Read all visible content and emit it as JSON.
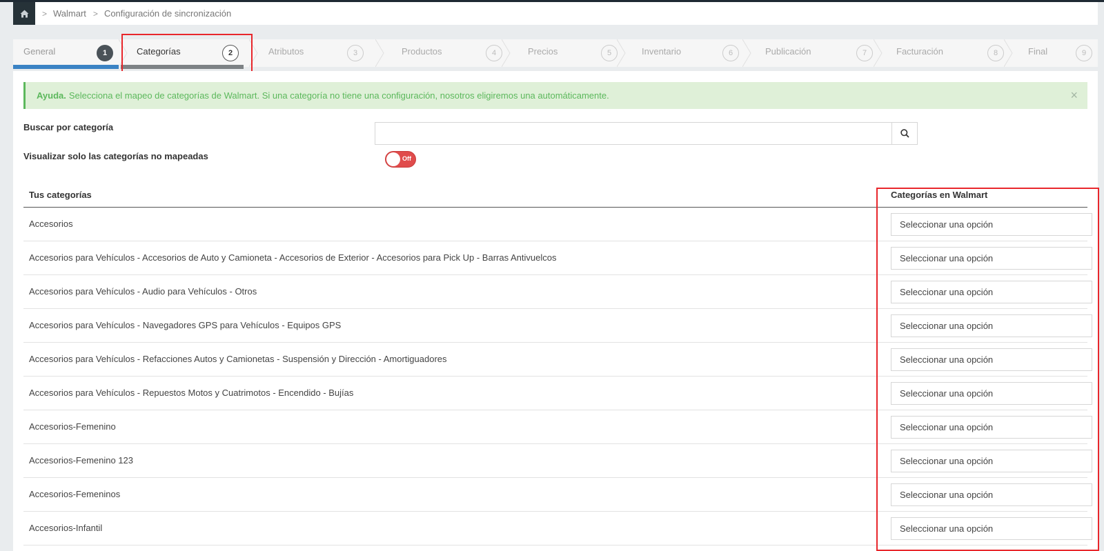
{
  "breadcrumb": {
    "home_icon": "home-icon",
    "items": [
      "Walmart",
      "Configuración de sincronización"
    ]
  },
  "wizard": {
    "steps": [
      {
        "label": "General",
        "num": "1",
        "state": "done"
      },
      {
        "label": "Categorías",
        "num": "2",
        "state": "active"
      },
      {
        "label": "Atributos",
        "num": "3",
        "state": "pending"
      },
      {
        "label": "Productos",
        "num": "4",
        "state": "pending"
      },
      {
        "label": "Precios",
        "num": "5",
        "state": "pending"
      },
      {
        "label": "Inventario",
        "num": "6",
        "state": "pending"
      },
      {
        "label": "Publicación",
        "num": "7",
        "state": "pending"
      },
      {
        "label": "Facturación",
        "num": "8",
        "state": "pending"
      },
      {
        "label": "Final",
        "num": "9",
        "state": "pending"
      }
    ]
  },
  "alert": {
    "bold": "Ayuda.",
    "text": "Selecciona el mapeo de categorías de Walmart. Si una categoría no tiene una configuración, nosotros eligiremos una automáticamente.",
    "close": "×"
  },
  "search": {
    "label": "Buscar por categoría",
    "value": "",
    "placeholder": ""
  },
  "filter": {
    "label": "Visualizar solo las categorías no mapeadas",
    "toggle_text": "Off"
  },
  "table": {
    "col_left": "Tus categorías",
    "col_right": "Categorías en Walmart",
    "rows": [
      {
        "category": "Accesorios",
        "walmart": "Seleccionar una opción"
      },
      {
        "category": "Accesorios para Vehículos - Accesorios de Auto y Camioneta - Accesorios de Exterior - Accesorios para Pick Up - Barras Antivuelcos",
        "walmart": "Seleccionar una opción"
      },
      {
        "category": "Accesorios para Vehículos - Audio para Vehículos - Otros",
        "walmart": "Seleccionar una opción"
      },
      {
        "category": "Accesorios para Vehículos - Navegadores GPS para Vehículos - Equipos GPS",
        "walmart": "Seleccionar una opción"
      },
      {
        "category": "Accesorios para Vehículos - Refacciones Autos y Camionetas - Suspensión y Dirección - Amortiguadores",
        "walmart": "Seleccionar una opción"
      },
      {
        "category": "Accesorios para Vehículos - Repuestos Motos y Cuatrimotos - Encendido - Bujías",
        "walmart": "Seleccionar una opción"
      },
      {
        "category": "Accesorios-Femenino",
        "walmart": "Seleccionar una opción"
      },
      {
        "category": "Accesorios-Femenino 123",
        "walmart": "Seleccionar una opción"
      },
      {
        "category": "Accesorios-Femeninos",
        "walmart": "Seleccionar una opción"
      },
      {
        "category": "Accesorios-Infantil",
        "walmart": "Seleccionar una opción"
      }
    ]
  },
  "colors": {
    "accent_blue": "#3b83c4",
    "highlight_red": "#e8262b",
    "alert_green": "#5cb85c",
    "toggle_red": "#e04c4c"
  }
}
